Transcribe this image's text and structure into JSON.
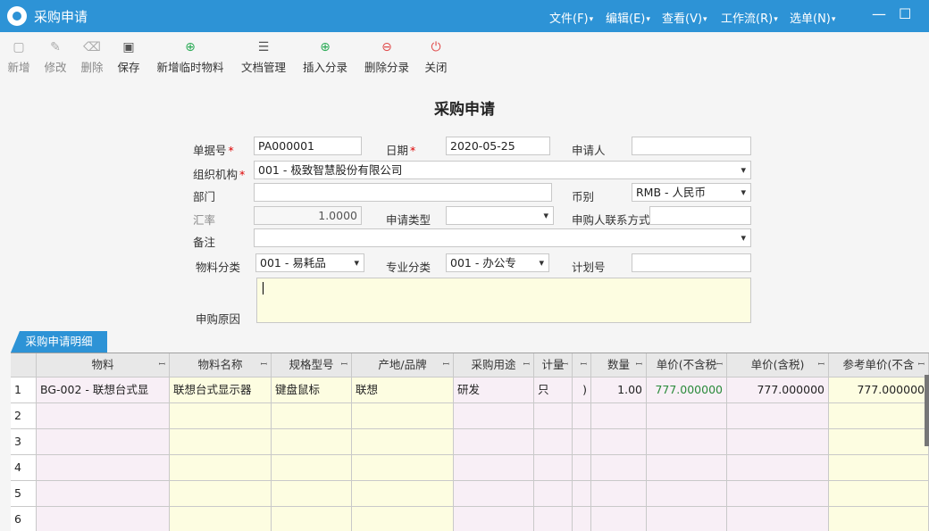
{
  "app": {
    "title": "采购申请"
  },
  "menu": [
    "文件(F)",
    "编辑(E)",
    "查看(V)",
    "工作流(R)",
    "选单(N)"
  ],
  "window_buttons": {
    "minimize": "—",
    "maximize": "☐",
    "close": "✕"
  },
  "toolbar": [
    {
      "label": "新增",
      "icon": "new-doc-icon"
    },
    {
      "label": "修改",
      "icon": "edit-icon"
    },
    {
      "label": "删除",
      "icon": "trash-icon"
    },
    {
      "label": "保存",
      "icon": "save-icon"
    },
    {
      "label": "新增临时物料",
      "icon": "plus-circle-icon"
    },
    {
      "label": "文档管理",
      "icon": "document-icon"
    },
    {
      "label": "插入分录",
      "icon": "plus-circle-icon"
    },
    {
      "label": "删除分录",
      "icon": "minus-circle-icon"
    },
    {
      "label": "关闭",
      "icon": "power-icon"
    }
  ],
  "form": {
    "title": "采购申请",
    "doc_no_label": "单据号",
    "doc_no": "PA000001",
    "date_label": "日期",
    "date": "2020-05-25",
    "applicant_label": "申请人",
    "applicant": "",
    "org_label": "组织机构",
    "org": "001 - 极致智慧股份有限公司",
    "dept_label": "部门",
    "dept": "",
    "currency_label": "币别",
    "currency": "RMB - 人民币",
    "rate_label": "汇率",
    "rate": "1.0000",
    "req_type_label": "申请类型",
    "req_type": "",
    "contact_label": "申购人联系方式",
    "contact": "",
    "remark_label": "备注",
    "remark": "",
    "mat_cat_label": "物料分类",
    "mat_cat": "001 - 易耗品",
    "spec_cat_label": "专业分类",
    "spec_cat": "001 - 办公专",
    "plan_no_label": "计划号",
    "plan_no": "",
    "reason_label": "申购原因",
    "reason": "",
    "required_mark": "*"
  },
  "detail": {
    "tab_label": "采购申请明细",
    "columns": [
      "物料",
      "物料名称",
      "规格型号",
      "产地/品牌",
      "采购用途",
      "计量",
      "",
      "数量",
      "单价(不含税",
      "单价(含税)",
      "参考单价(不含"
    ],
    "rows": [
      {
        "no": "1",
        "cells": [
          "BG-002 - 联想台式显",
          "联想台式显示器",
          "键盘鼠标",
          "联想",
          "研发",
          "只",
          ")",
          "1.00",
          "777.000000",
          "777.000000",
          "777.000000"
        ]
      },
      {
        "no": "2",
        "cells": [
          "",
          "",
          "",
          "",
          "",
          "",
          "",
          "",
          "",
          "",
          ""
        ]
      },
      {
        "no": "3",
        "cells": [
          "",
          "",
          "",
          "",
          "",
          "",
          "",
          "",
          "",
          "",
          ""
        ]
      },
      {
        "no": "4",
        "cells": [
          "",
          "",
          "",
          "",
          "",
          "",
          "",
          "",
          "",
          "",
          ""
        ]
      },
      {
        "no": "5",
        "cells": [
          "",
          "",
          "",
          "",
          "",
          "",
          "",
          "",
          "",
          "",
          ""
        ]
      },
      {
        "no": "6",
        "cells": [
          "",
          "",
          "",
          "",
          "",
          "",
          "",
          "",
          "",
          "",
          ""
        ]
      }
    ]
  },
  "colors": {
    "titlebar": "#2d93d6",
    "required": "#dd0000",
    "cell_yellow": "#fdfde1",
    "cell_pink": "#f8eff6",
    "unit_price_green": "#2a8a3a"
  }
}
